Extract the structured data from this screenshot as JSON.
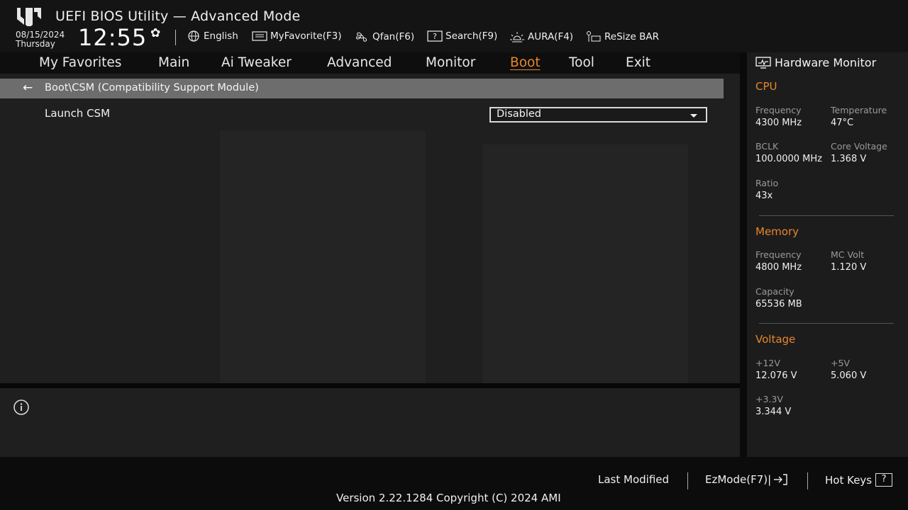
{
  "header": {
    "title": "UEFI BIOS Utility — Advanced Mode",
    "date": "08/15/2024",
    "weekday": "Thursday",
    "time": "12:55",
    "tools": [
      {
        "label": "English",
        "icon": "globe-icon"
      },
      {
        "label": "MyFavorite(F3)",
        "icon": "favorite-icon"
      },
      {
        "label": "Qfan(F6)",
        "icon": "fan-icon"
      },
      {
        "label": "Search(F9)",
        "icon": "search-icon"
      },
      {
        "label": "AURA(F4)",
        "icon": "aura-icon"
      },
      {
        "label": "ReSize BAR",
        "icon": "resize-bar-icon"
      }
    ]
  },
  "tabs": [
    {
      "label": "My Favorites"
    },
    {
      "label": "Main"
    },
    {
      "label": "Ai Tweaker"
    },
    {
      "label": "Advanced"
    },
    {
      "label": "Monitor"
    },
    {
      "label": "Boot",
      "active": true
    },
    {
      "label": "Tool"
    },
    {
      "label": "Exit"
    }
  ],
  "main": {
    "breadcrumb": "Boot\\CSM (Compatibility Support Module)",
    "settings": [
      {
        "label": "Launch CSM",
        "value": "Disabled"
      }
    ]
  },
  "hardware_monitor": {
    "title": "Hardware Monitor",
    "cpu": {
      "section": "CPU",
      "frequency_label": "Frequency",
      "frequency": "4300 MHz",
      "temperature_label": "Temperature",
      "temperature": "47°C",
      "bclk_label": "BCLK",
      "bclk": "100.0000 MHz",
      "core_voltage_label": "Core Voltage",
      "core_voltage": "1.368 V",
      "ratio_label": "Ratio",
      "ratio": "43x"
    },
    "memory": {
      "section": "Memory",
      "frequency_label": "Frequency",
      "frequency": "4800 MHz",
      "mc_volt_label": "MC Volt",
      "mc_volt": "1.120 V",
      "capacity_label": "Capacity",
      "capacity": "65536 MB"
    },
    "voltage": {
      "section": "Voltage",
      "v12_label": "+12V",
      "v12": "12.076 V",
      "v5_label": "+5V",
      "v5": "5.060 V",
      "v33_label": "+3.3V",
      "v33": "3.344 V"
    }
  },
  "footer": {
    "last_modified": "Last Modified",
    "ezmode": "EzMode(F7)|",
    "hot_keys": "Hot Keys",
    "hot_keys_glyph": "?",
    "version": "Version 2.22.1284 Copyright (C) 2024 AMI"
  },
  "colors": {
    "accent": "#e8862c",
    "background": "#1f1f1f",
    "breadcrumb_bar": "#6d6d6d"
  }
}
